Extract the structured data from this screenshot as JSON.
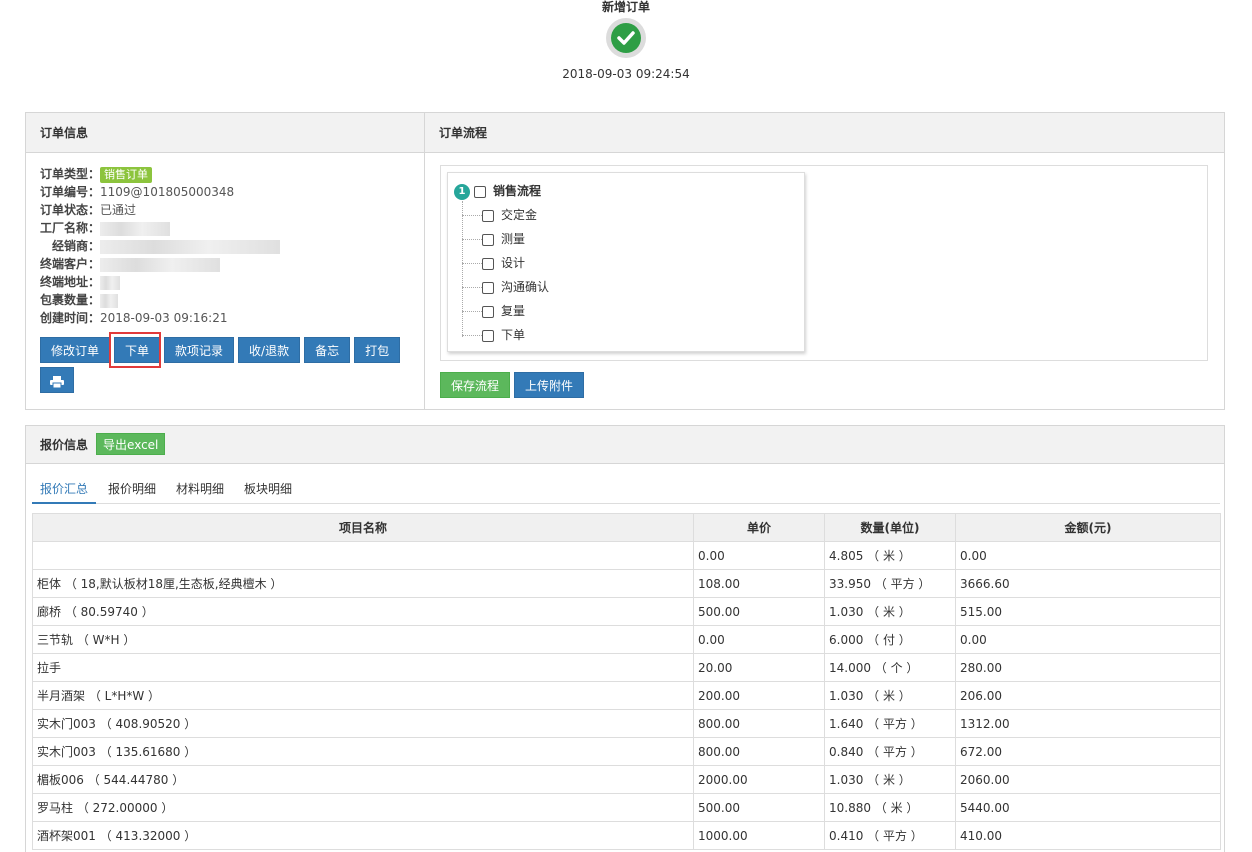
{
  "step": {
    "title": "新增订单",
    "time": "2018-09-03 09:24:54"
  },
  "order_panel": {
    "title": "订单信息",
    "fields": [
      {
        "key": "订单类型：",
        "badge": "销售订单"
      },
      {
        "key": "订单编号：",
        "value": "1109@101805000348"
      },
      {
        "key": "订单状态：",
        "value": "已通过"
      },
      {
        "key": "工厂名称：",
        "value": ""
      },
      {
        "key": "经销商：",
        "value": ""
      },
      {
        "key": "终端客户：",
        "value": ""
      },
      {
        "key": "终端地址：",
        "value": ""
      },
      {
        "key": "包裹数量：",
        "value": ""
      },
      {
        "key": "创建时间：",
        "value": "2018-09-03 09:16:21"
      }
    ],
    "buttons": [
      "修改订单",
      "下单",
      "款项记录",
      "收/退款",
      "备忘",
      "打包"
    ],
    "print_icon": "printer-icon"
  },
  "flow_panel": {
    "title": "订单流程",
    "root_number": "1",
    "root_label": "销售流程",
    "items": [
      "交定金",
      "测量",
      "设计",
      "沟通确认",
      "复量",
      "下单"
    ],
    "save_label": "保存流程",
    "upload_label": "上传附件"
  },
  "quote_panel": {
    "title": "报价信息",
    "export_label": "导出excel",
    "tabs": [
      "报价汇总",
      "报价明细",
      "材料明细",
      "板块明细"
    ],
    "columns": [
      "项目名称",
      "单价",
      "数量(单位)",
      "金额(元)"
    ],
    "rows": [
      [
        "",
        "0.00",
        "4.805 （ 米 ）",
        "0.00"
      ],
      [
        "柜体 （ 18,默认板材18厘,生态板,经典檀木 ）",
        "108.00",
        "33.950 （ 平方 ）",
        "3666.60"
      ],
      [
        "廊桥 （ 80.59740 ）",
        "500.00",
        "1.030 （ 米 ）",
        "515.00"
      ],
      [
        "三节轨 （ W*H ）",
        "0.00",
        "6.000 （ 付 ）",
        "0.00"
      ],
      [
        "拉手",
        "20.00",
        "14.000 （ 个 ）",
        "280.00"
      ],
      [
        "半月酒架 （ L*H*W ）",
        "200.00",
        "1.030 （ 米 ）",
        "206.00"
      ],
      [
        "实木门003 （ 408.90520 ）",
        "800.00",
        "1.640 （ 平方 ）",
        "1312.00"
      ],
      [
        "实木门003 （ 135.61680 ）",
        "800.00",
        "0.840 （ 平方 ）",
        "672.00"
      ],
      [
        "楣板006 （ 544.44780 ）",
        "2000.00",
        "1.030 （ 米 ）",
        "2060.00"
      ],
      [
        "罗马柱 （ 272.00000 ）",
        "500.00",
        "10.880 （ 米 ）",
        "5440.00"
      ],
      [
        "酒杯架001 （ 413.32000 ）",
        "1000.00",
        "0.410 （ 平方 ）",
        "410.00"
      ]
    ]
  },
  "colors": {
    "primary": "#337ab7",
    "success": "#5cb85c",
    "badge": "#8cc43d",
    "highlight": "#e23a3a"
  }
}
